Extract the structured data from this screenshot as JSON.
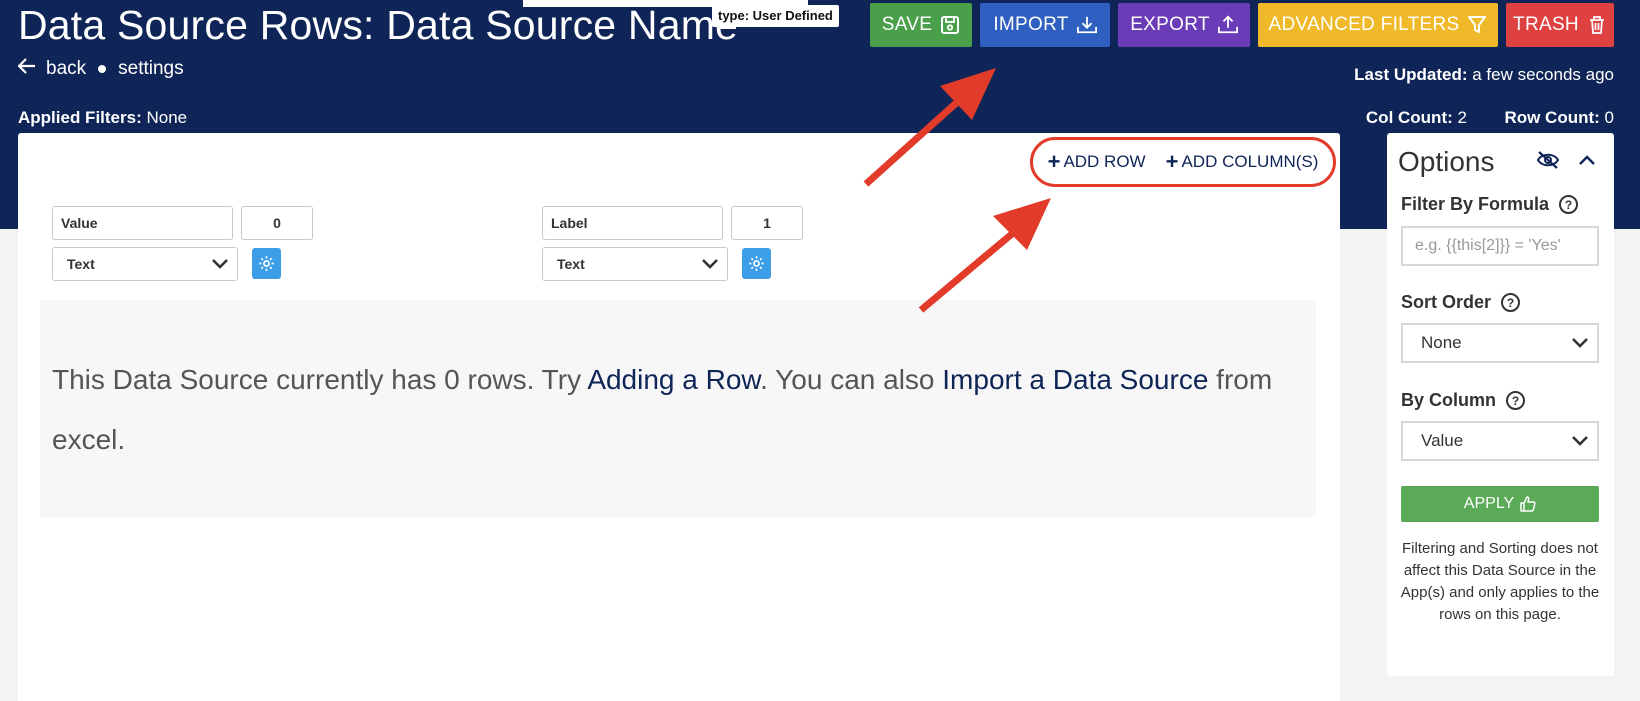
{
  "header": {
    "title": "Data Source Rows: Data Source Name",
    "type_badge": "type: User Defined",
    "back_label": "back",
    "settings_label": "settings",
    "last_updated_label": "Last Updated:",
    "last_updated_value": "a few seconds ago",
    "applied_filters_label": "Applied Filters:",
    "applied_filters_value": "None",
    "col_count_label": "Col Count:",
    "col_count_value": "2",
    "row_count_label": "Row Count:",
    "row_count_value": "0"
  },
  "toolbar": {
    "save_label": "SAVE",
    "import_label": "IMPORT",
    "export_label": "EXPORT",
    "advanced_filters_label": "ADVANCED FILTERS",
    "trash_label": "TRASH"
  },
  "actions": {
    "add_row_label": "ADD ROW",
    "add_columns_label": "ADD COLUMN(S)"
  },
  "columns": [
    {
      "name": "Value",
      "index": "0",
      "type": "Text"
    },
    {
      "name": "Label",
      "index": "1",
      "type": "Text"
    }
  ],
  "empty_state": {
    "text_before": "This Data Source currently has 0 rows. Try ",
    "link_add_row": "Adding a Row",
    "text_middle": ". You can also ",
    "link_import": "Import a Data Source",
    "text_after": " from excel."
  },
  "options": {
    "title": "Options",
    "filter_label": "Filter By Formula",
    "filter_placeholder": "e.g. {{this[2]}} = 'Yes'",
    "sort_label": "Sort Order",
    "sort_value": "None",
    "by_column_label": "By Column",
    "by_column_value": "Value",
    "apply_label": "APPLY",
    "note": "Filtering and Sorting does not affect this Data Source in the App(s) and only applies to the rows on this page."
  },
  "colors": {
    "header_bg": "#0f2557",
    "save": "#4a9f4a",
    "import": "#2f5fc0",
    "export": "#6b3cb8",
    "advanced_filters": "#f0b92a",
    "trash": "#df4040",
    "annotation": "#e23b2a",
    "gear": "#3d9ee8",
    "apply": "#5aaa58"
  }
}
